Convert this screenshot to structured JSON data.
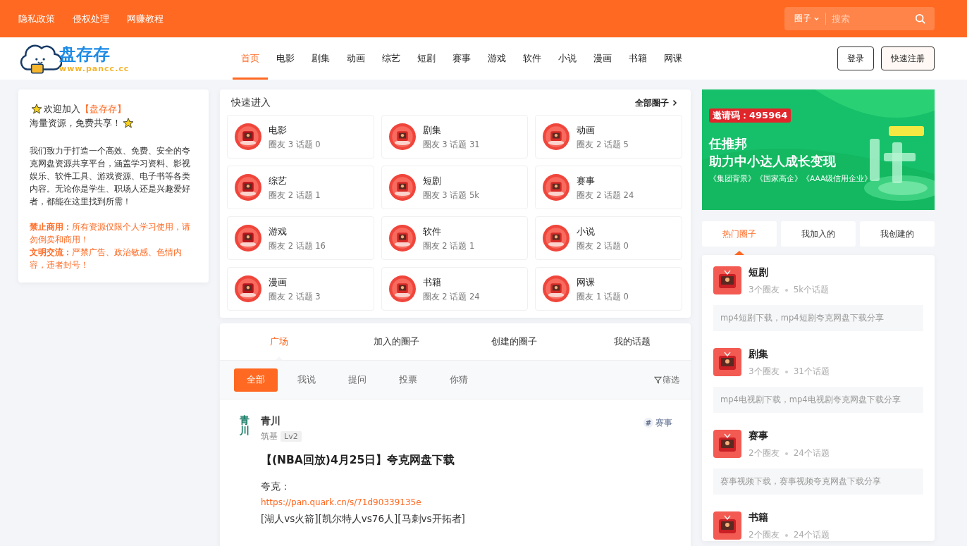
{
  "top_links": [
    "隐私政策",
    "侵权处理",
    "网赚教程"
  ],
  "search": {
    "scope": "圈子",
    "placeholder": "搜索"
  },
  "logo": {
    "name": "盘存存",
    "url": "www.pancc.cc"
  },
  "nav": [
    {
      "label": "首页",
      "selected": true
    },
    {
      "label": "电影",
      "selected": false
    },
    {
      "label": "剧集",
      "selected": false
    },
    {
      "label": "动画",
      "selected": false
    },
    {
      "label": "综艺",
      "selected": false
    },
    {
      "label": "短剧",
      "selected": false
    },
    {
      "label": "赛事",
      "selected": false
    },
    {
      "label": "游戏",
      "selected": false
    },
    {
      "label": "软件",
      "selected": false
    },
    {
      "label": "小说",
      "selected": false
    },
    {
      "label": "漫画",
      "selected": false
    },
    {
      "label": "书籍",
      "selected": false
    },
    {
      "label": "网课",
      "selected": false
    }
  ],
  "auth_buttons": [
    "登录",
    "快速注册"
  ],
  "welcome": {
    "lead": "欢迎加入",
    "brand": "【盘存存】",
    "tagline": "海量资源，免费共享！",
    "intro": "我们致力于打造一个高效、免费、安全的夸克网盘资源共享平台，涵盖学习资料、影视娱乐、软件工具、游戏资源、电子书等各类内容。无论你是学生、职场人还是兴趣爱好者，都能在这里找到所需！",
    "rules": [
      "**禁止商用：**所有资源仅限个人学习使用，请勿倒卖和商用！",
      "**文明交流：**严禁广告、政治敏感、色情内容，违者封号！"
    ]
  },
  "quick": {
    "title": "快速进入",
    "all_link": "全部圈子",
    "circles": [
      {
        "name": "电影",
        "stats": "圈友 3 话题 0"
      },
      {
        "name": "剧集",
        "stats": "圈友 3 话题 31"
      },
      {
        "name": "动画",
        "stats": "圈友 2 话题 5"
      },
      {
        "name": "综艺",
        "stats": "圈友 2 话题 1"
      },
      {
        "name": "短剧",
        "stats": "圈友 3 话题 5k"
      },
      {
        "name": "赛事",
        "stats": "圈友 2 话题 24"
      },
      {
        "name": "游戏",
        "stats": "圈友 2 话题 16"
      },
      {
        "name": "软件",
        "stats": "圈友 2 话题 1"
      },
      {
        "name": "小说",
        "stats": "圈友 2 话题 0"
      },
      {
        "name": "漫画",
        "stats": "圈友 2 话题 3"
      },
      {
        "name": "书籍",
        "stats": "圈友 2 话题 24"
      },
      {
        "name": "网课",
        "stats": "圈友 1 话题 0"
      }
    ]
  },
  "feed": {
    "tabs": [
      {
        "label": "广场",
        "selected": true
      },
      {
        "label": "加入的圈子",
        "selected": false
      },
      {
        "label": "创建的圈子",
        "selected": false
      },
      {
        "label": "我的话题",
        "selected": false
      }
    ],
    "filters": [
      {
        "label": "全部",
        "selected": true
      },
      {
        "label": "我说",
        "selected": false
      },
      {
        "label": "提问",
        "selected": false
      },
      {
        "label": "投票",
        "selected": false
      },
      {
        "label": "你猜",
        "selected": false
      }
    ],
    "filter_button": "筛选",
    "post": {
      "avatar_text": "青川",
      "author": "青川",
      "rank": "筑基",
      "level": "Lv2",
      "tag_mark": "#",
      "tag": "赛事",
      "title": "【(NBA回放)4月25日】夸克网盘下载",
      "body_label": "夸克：",
      "link": "https://pan.quark.cn/s/71d90339135e",
      "teams": "[湖人vs火箭][凯尔特人vs76人][马刺vs开拓者]"
    }
  },
  "banner": {
    "invite": "邀请码：495964",
    "headline": [
      "任推邦",
      "助力中小达人成长变现"
    ],
    "badges": "《集团背景》《国家高企》《AAA级信用企业》"
  },
  "side_tabs": [
    {
      "label": "热门圈子",
      "selected": true
    },
    {
      "label": "我加入的",
      "selected": false
    },
    {
      "label": "我创建的",
      "selected": false
    }
  ],
  "hot": [
    {
      "name": "短剧",
      "members": "3个圈友",
      "topics": "5k个话题",
      "desc": "mp4短剧下载，mp4短剧夸克网盘下载分享"
    },
    {
      "name": "剧集",
      "members": "3个圈友",
      "topics": "31个话题",
      "desc": "mp4电视剧下载，mp4电视剧夸克网盘下载分享"
    },
    {
      "name": "赛事",
      "members": "2个圈友",
      "topics": "24个话题",
      "desc": "赛事视频下载，赛事视频夸克网盘下载分享"
    },
    {
      "name": "书籍",
      "members": "2个圈友",
      "topics": "24个话题"
    }
  ]
}
